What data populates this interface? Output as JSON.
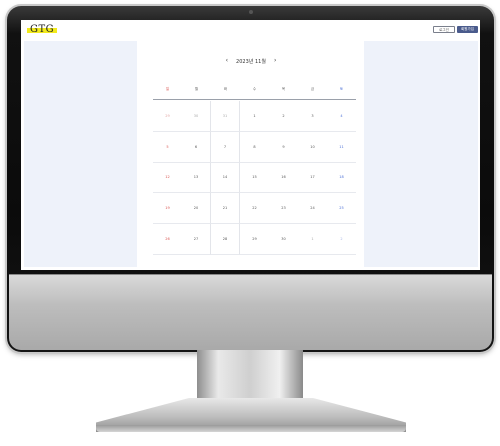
{
  "header": {
    "logo": "GTG",
    "login_label": "로그인",
    "signup_label": "회원가입"
  },
  "calendar": {
    "title": "2023년 11월",
    "prev_icon": "chevron-left-icon",
    "next_icon": "chevron-right-icon",
    "weekdays": [
      "일",
      "월",
      "화",
      "수",
      "목",
      "금",
      "토"
    ],
    "weeks": [
      [
        "29",
        "30",
        "31",
        "1",
        "2",
        "3",
        "4"
      ],
      [
        "5",
        "6",
        "7",
        "8",
        "9",
        "10",
        "11"
      ],
      [
        "12",
        "13",
        "14",
        "15",
        "16",
        "17",
        "18"
      ],
      [
        "19",
        "20",
        "21",
        "22",
        "23",
        "24",
        "25"
      ],
      [
        "26",
        "27",
        "28",
        "29",
        "30",
        "1",
        "2"
      ]
    ],
    "colors": {
      "sunday": "#d9534f",
      "saturday": "#4a6fd6",
      "sidebar": "#eef2fa",
      "signup_button": "#4a5b8c",
      "logo_highlight": "#f2ea1c"
    }
  }
}
